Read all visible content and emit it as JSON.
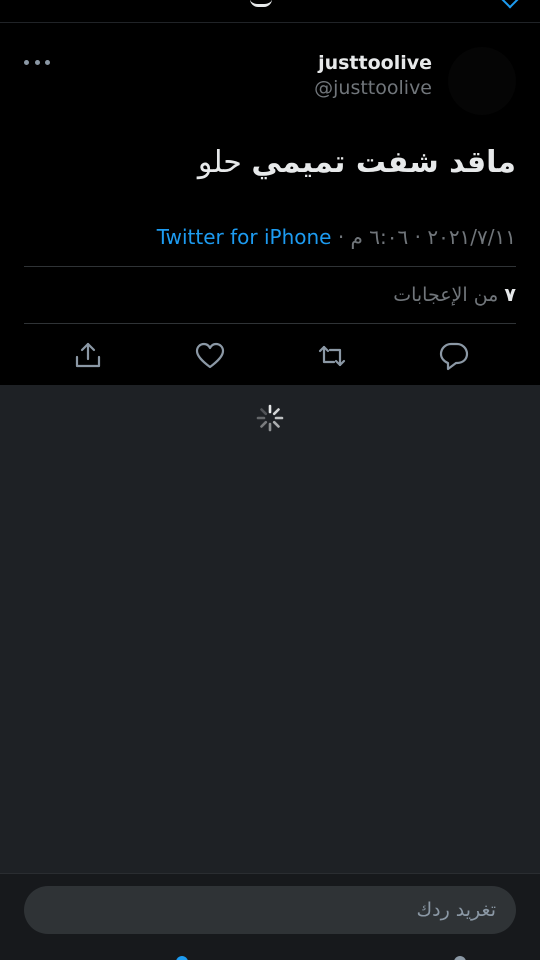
{
  "tweet": {
    "display_name": "justtoolive",
    "handle": "@justtoolive",
    "text_bold": "ماقد شفت تميمي",
    "text_rest": "حلو",
    "date_time": "٢٠٢١/٧/١١ · ٦:٠٦ م · ",
    "source": "Twitter for iPhone",
    "likes_count": "٧",
    "likes_label": "من الإعجابات"
  },
  "icons": {
    "more": "more-horizontal-icon",
    "share": "share-icon",
    "like": "heart-icon",
    "retweet": "retweet-icon",
    "reply": "reply-icon",
    "loading": "loading-spinner-icon"
  },
  "composer": {
    "placeholder": "تغريد ردك",
    "value": ""
  },
  "colors": {
    "background": "#000000",
    "replies_background": "#1e2125",
    "accent": "#1d9bf0",
    "secondary_text": "#71767b",
    "primary_text": "#e7e9ea"
  }
}
